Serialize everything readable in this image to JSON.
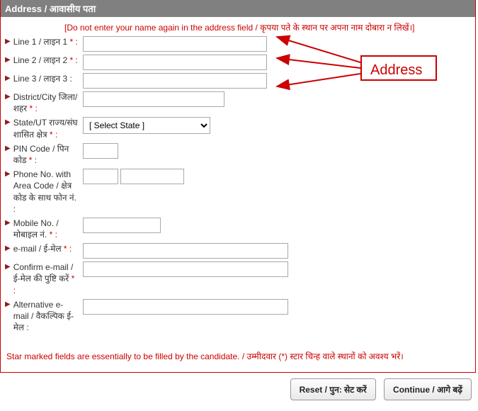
{
  "header": {
    "title": "Address / आवासीय पता"
  },
  "warning": "[Do not enter your name again in the address field / कृपया पते के स्थान पर अपना नाम दोबारा न लिखें।]",
  "fields": {
    "line1": {
      "label": "Line 1 / लाइन 1",
      "required": true
    },
    "line2": {
      "label": "Line 2 / लाइन 2",
      "required": true
    },
    "line3": {
      "label": "Line 3 / लाइन 3",
      "required": false
    },
    "district": {
      "label": "District/City जिला/शहर",
      "required": true
    },
    "state": {
      "label": "State/UT राज्य/संघ शासित क्षेत्र",
      "required": true,
      "placeholder": "[ Select State ]"
    },
    "pin": {
      "label": "PIN Code / पिन कोड",
      "required": true
    },
    "phone": {
      "label": "Phone No. with Area Code / क्षेत्र कोड के साथ फोन नं.",
      "required": false
    },
    "mobile": {
      "label": "Mobile No. / मोबाइल नं.",
      "required": true
    },
    "email": {
      "label": "e-mail / ई-मेल",
      "required": true
    },
    "cemail": {
      "label": "Confirm e-mail / ई-मेल की पुष्टि करें",
      "required": true
    },
    "aemail": {
      "label": "Alternative e-mail / वैकल्पिक ई-मेल",
      "required": false
    }
  },
  "punct": {
    "req_colon": " * :",
    "colon": " :"
  },
  "footer_note": "Star marked fields are essentially to be filled by the candidate. / उम्मीदवार (*) स्टार चिन्ह वाले स्थानों को अवश्य भरें।",
  "buttons": {
    "reset": "Reset / पुन: सेट करें",
    "continue": "Continue / आगे बढ़ें"
  },
  "annotation": {
    "label": "Address"
  }
}
